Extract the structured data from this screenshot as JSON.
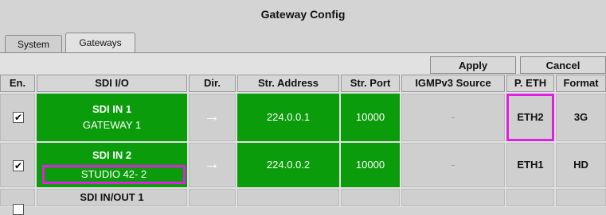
{
  "window": {
    "title": "Gateway Config"
  },
  "tabs": [
    {
      "label": "System"
    },
    {
      "label": "Gateways"
    }
  ],
  "toolbar": {
    "apply_label": "Apply",
    "cancel_label": "Cancel"
  },
  "table": {
    "columns": [
      "En.",
      "SDI I/O",
      "Dir.",
      "Str. Address",
      "Str. Port",
      "IGMPv3 Source",
      "P. ETH",
      "Format"
    ],
    "rows": [
      {
        "enabled": true,
        "checkbox": "✔",
        "sdi_name": "SDI IN 1",
        "sdi_label": "GATEWAY 1",
        "direction": "→",
        "address": "224.0.0.1",
        "port": "10000",
        "igmp": "-",
        "eth": "ETH2",
        "format": "3G"
      },
      {
        "enabled": true,
        "checkbox": "✔",
        "sdi_name": "SDI IN 2",
        "sdi_label": "STUDIO 42- 2",
        "direction": "→",
        "address": "224.0.0.2",
        "port": "10000",
        "igmp": "-",
        "eth": "ETH1",
        "format": "HD"
      },
      {
        "enabled": false,
        "sdi_name": "SDI IN/OUT 1"
      }
    ]
  },
  "colors": {
    "active_green": "#0b9c0b",
    "highlight": "#e020e0"
  }
}
